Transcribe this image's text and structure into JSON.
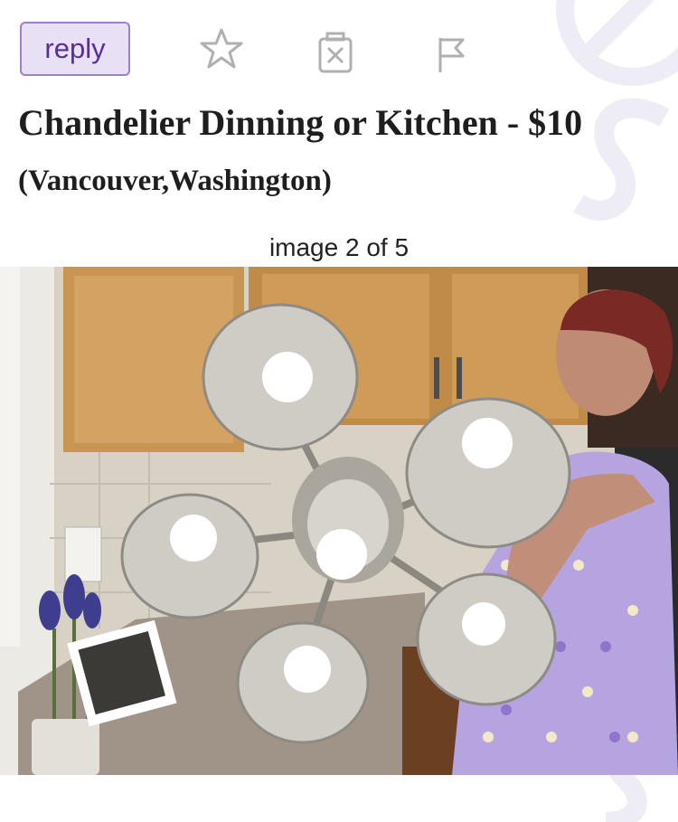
{
  "toolbar": {
    "reply_label": "reply",
    "icons": [
      "star-icon",
      "trash-icon",
      "flag-icon"
    ]
  },
  "listing": {
    "title": "Chandelier Dinning or Kitchen - $10",
    "location": "(Vancouver,Washington)"
  },
  "gallery": {
    "counter": "image 2 of 5"
  },
  "colors": {
    "reply_bg": "#e8e0f5",
    "reply_border": "#9d80c6",
    "reply_text": "#5b2d98",
    "icon_gray": "#b0b0b0",
    "watermark": "#eeedf5"
  }
}
